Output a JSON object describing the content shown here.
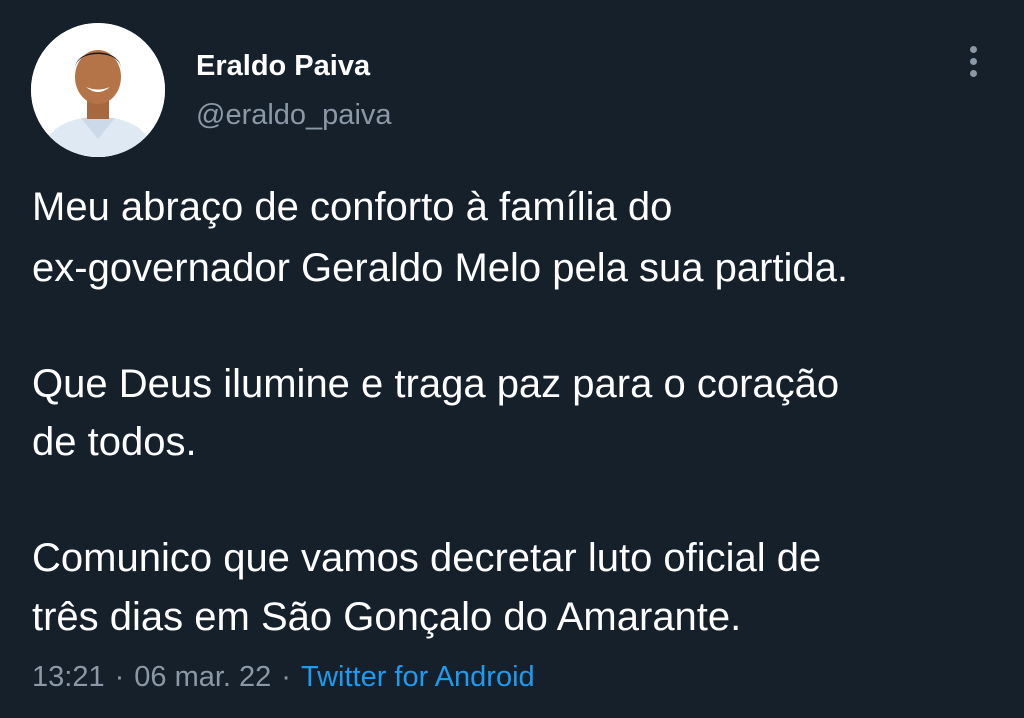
{
  "author": {
    "name": "Eraldo Paiva",
    "handle": "@eraldo_paiva"
  },
  "icons": {
    "more": "more-vertical-icon"
  },
  "tweet": {
    "lines": [
      "Meu abraço de conforto à família do",
      "ex-governador Geraldo Melo pela sua partida.",
      "Que Deus ilumine e traga paz para o coração",
      "de todos.",
      "Comunico que vamos decretar luto oficial de",
      "três dias em São Gonçalo do Amarante."
    ]
  },
  "meta": {
    "time": "13:21",
    "separator": "·",
    "date": "06 mar. 22",
    "source": "Twitter for Android"
  },
  "colors": {
    "background": "#15202b",
    "text": "#ffffff",
    "muted": "#8b98a5",
    "link": "#1d9bf0"
  }
}
